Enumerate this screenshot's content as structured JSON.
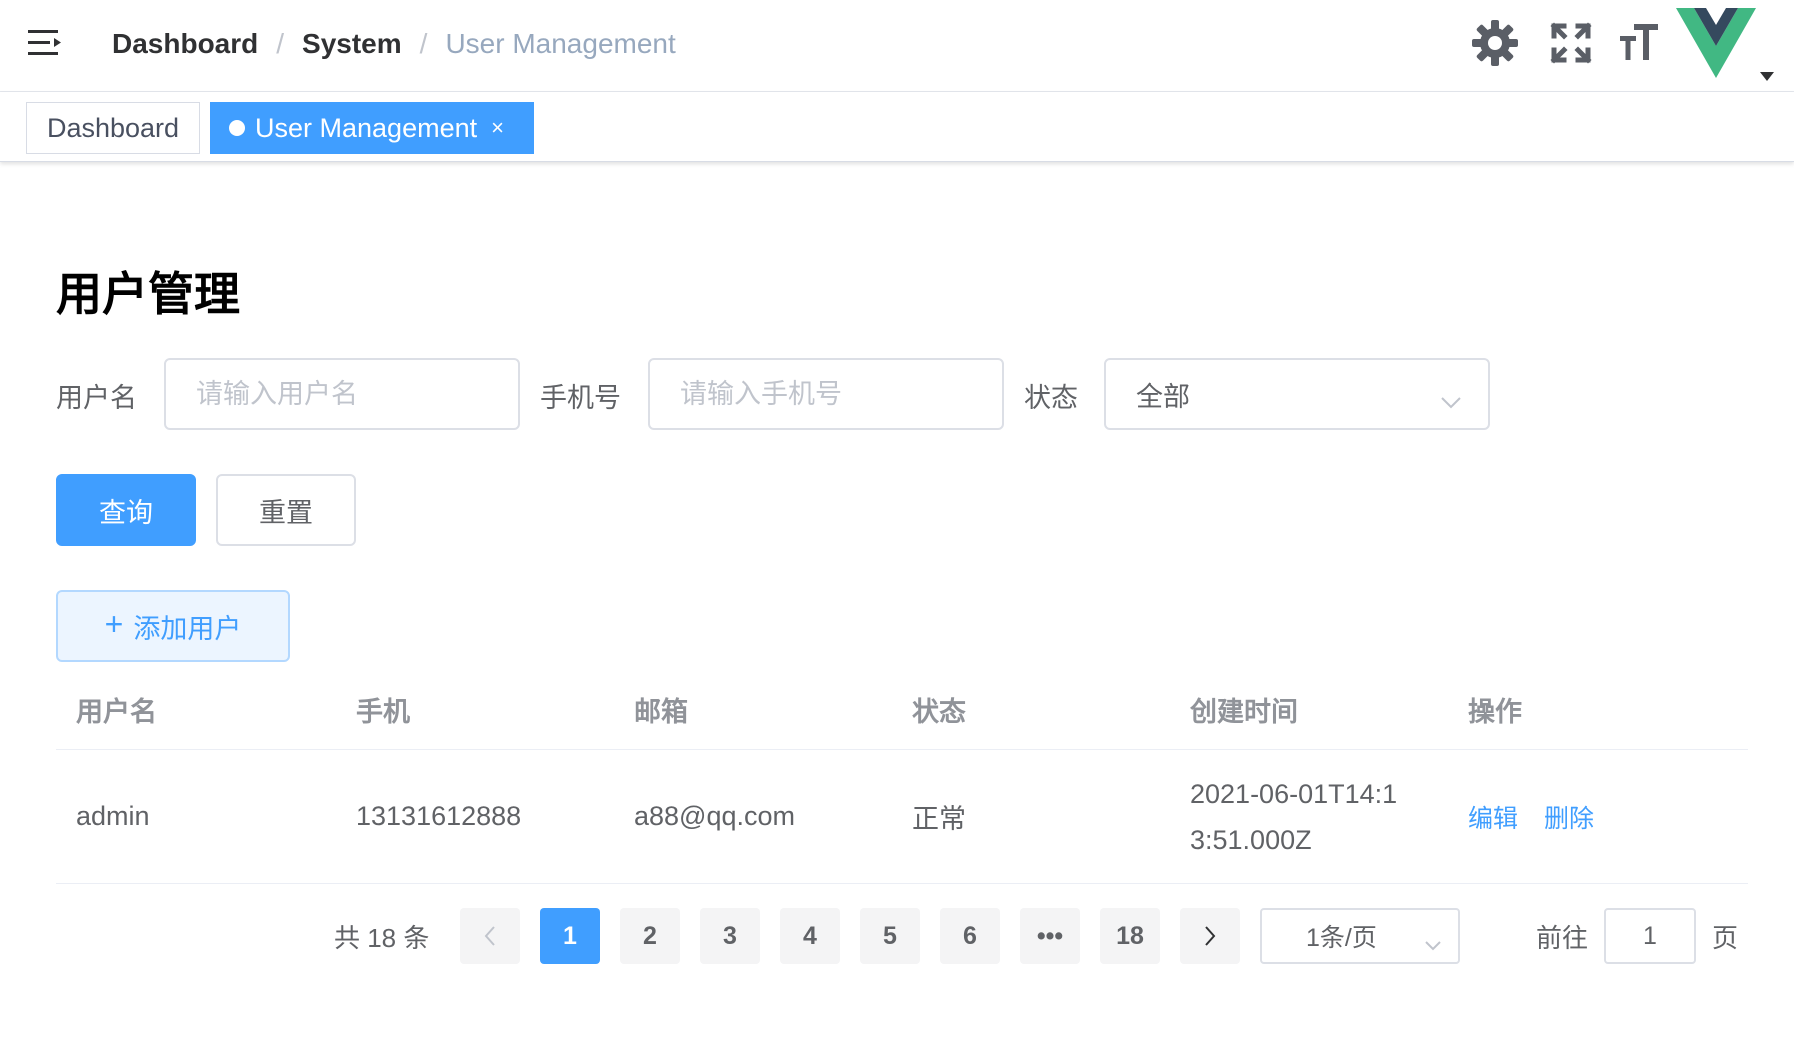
{
  "navbar": {
    "breadcrumb": [
      "Dashboard",
      "System",
      "User Management"
    ],
    "icons": [
      "hamburger-icon",
      "gear-icon",
      "fullscreen-icon",
      "font-size-icon",
      "vue-logo",
      "caret-down-icon"
    ],
    "brand_colors": {
      "vue_green": "#41b883",
      "vue_dark": "#35495e"
    }
  },
  "tags": {
    "items": [
      {
        "label": "Dashboard",
        "active": false
      },
      {
        "label": "User Management",
        "active": true,
        "close": "×"
      }
    ],
    "active_color": "#409eff"
  },
  "page": {
    "title": "用户管理"
  },
  "filters": {
    "username_label": "用户名",
    "username_placeholder": "请输入用户名",
    "phone_label": "手机号",
    "phone_placeholder": "请输入手机号",
    "status_label": "状态",
    "status_selected": "全部"
  },
  "actions": {
    "query": "查询",
    "reset": "重置",
    "add_user": "添加用户",
    "add_plus": "+"
  },
  "table": {
    "headers": [
      "用户名",
      "手机",
      "邮箱",
      "状态",
      "创建时间",
      "操作"
    ],
    "rows": [
      {
        "username": "admin",
        "phone": "13131612888",
        "email": "a88@qq.com",
        "status": "正常",
        "created_at": "2021-06-01T14:13:51.000Z",
        "edit": "编辑",
        "delete": "删除"
      }
    ]
  },
  "pagination": {
    "total_text": "共 18 条",
    "pages": [
      "1",
      "2",
      "3",
      "4",
      "5",
      "6",
      "•••",
      "18"
    ],
    "current": "1",
    "page_size": "1条/页",
    "goto_label": "前往",
    "goto_value": "1",
    "page_suffix": "页"
  },
  "colors": {
    "primary": "#409eff",
    "text": "#606266",
    "muted": "#909399",
    "border": "#dcdfe6"
  }
}
